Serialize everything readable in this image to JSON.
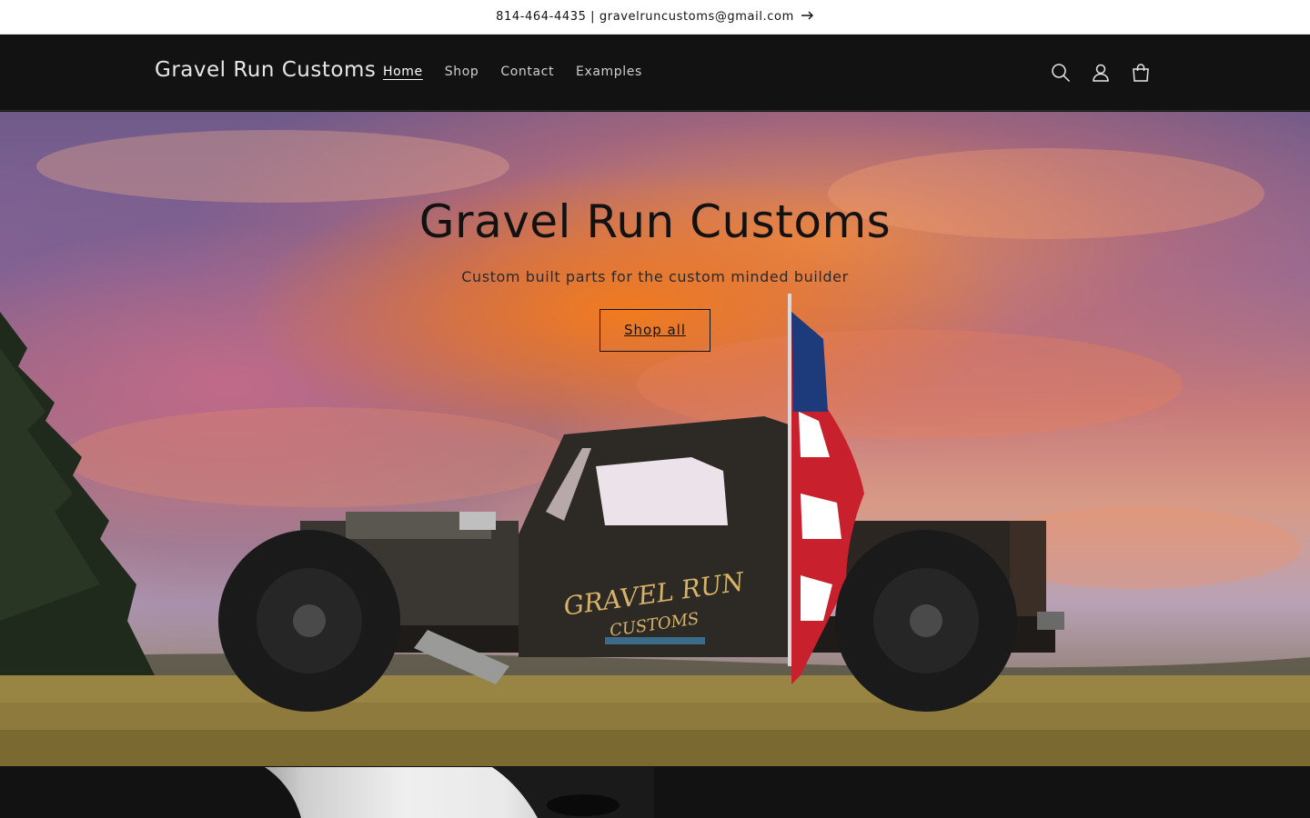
{
  "announcement": {
    "text": "814-464-4435 | gravelruncustoms@gmail.com",
    "arrow_icon": "arrow-right-icon"
  },
  "header": {
    "logo": "Gravel Run Customs",
    "nav": [
      {
        "label": "Home",
        "active": true
      },
      {
        "label": "Shop",
        "active": false
      },
      {
        "label": "Contact",
        "active": false
      },
      {
        "label": "Examples",
        "active": false
      }
    ],
    "icons": [
      "search-icon",
      "account-icon",
      "cart-icon"
    ]
  },
  "hero": {
    "title": "Gravel Run Customs",
    "subtitle": "Custom built parts for the custom minded builder",
    "button_label": "Shop all",
    "door_logo_line1": "GRAVEL RUN",
    "door_logo_line2": "CUSTOMS"
  },
  "colors": {
    "header_bg": "#121212",
    "announcement_bg": "#ffffff",
    "text_dark": "#121212",
    "text_light": "#e6e6e6"
  }
}
